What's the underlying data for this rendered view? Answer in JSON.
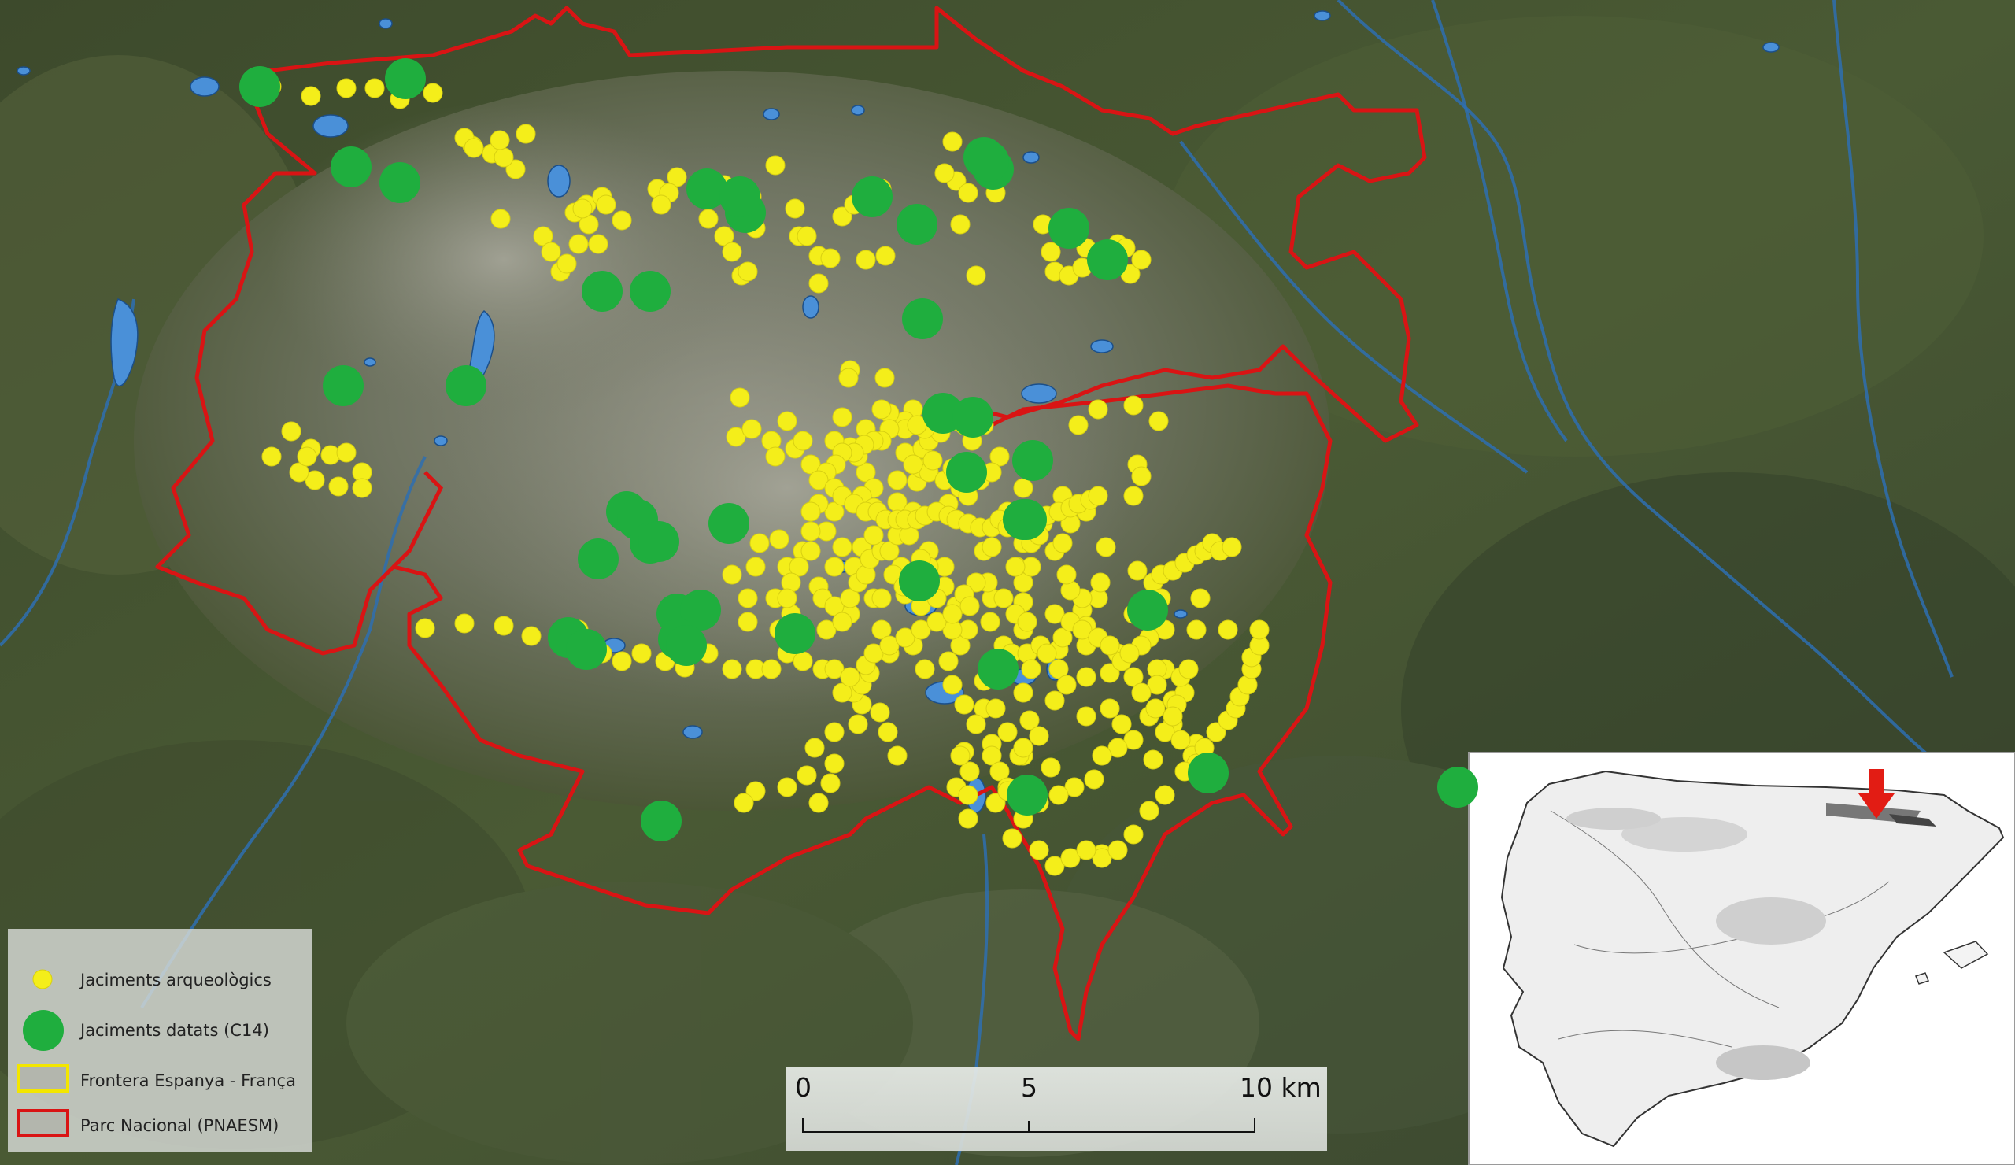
{
  "legend": {
    "sites_label": "Jaciments arqueològics",
    "dated_label": "Jaciments datats (C14)",
    "border_label": "Frontera Espanya - França",
    "park_label": "Parc Nacional (PNAESM)"
  },
  "scale_bar": {
    "label_start": "0",
    "label_mid": "5",
    "label_end": "10 km"
  },
  "colors": {
    "site": "#f4ee1a",
    "dated_site": "#1fae3e",
    "park_boundary": "#d91414",
    "border": "#f3e600",
    "lake": "#4a90d8",
    "arrow": "#e21c14"
  },
  "inset": {
    "description_icon": "iberian-peninsula-map",
    "arrow_icon": "red-arrow-down-icon"
  }
}
